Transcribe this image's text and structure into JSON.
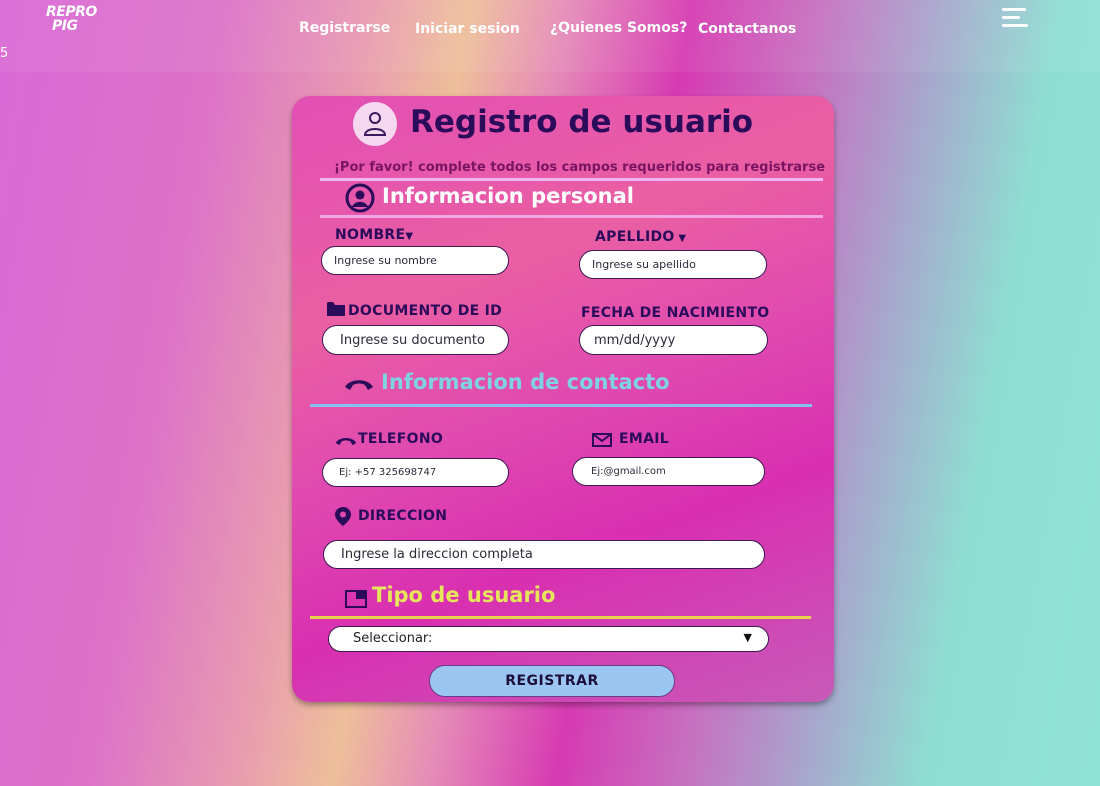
{
  "header": {
    "logo_line1": "REPRO",
    "logo_line2": "PIG",
    "stray_text": "5",
    "nav": [
      "Registrarse",
      "Iniciar sesion",
      "¿Quienes Somos?",
      "Contactanos"
    ],
    "menu_icon": "hamburger-icon"
  },
  "form": {
    "title": "Registro de usuario",
    "subtitle": "¡Por favor! complete todos los campos requeridos para registrarse",
    "sections": {
      "personal": "Informacion personal",
      "contact": "Informacion de contacto",
      "user_type": "Tipo de usuario"
    },
    "labels": {
      "nombre": "NOMBRE",
      "apellido": "APELLIDO",
      "documento": "DOCUMENTO DE ID",
      "fecha": "FECHA DE NACIMIENTO",
      "telefono": "TELEFONO",
      "email": "EMAIL",
      "direccion": "DIRECCION"
    },
    "placeholders": {
      "nombre": "Ingrese su nombre",
      "apellido": "Ingrese su apellido",
      "documento": "Ingrese su documento",
      "fecha": "mm/dd/yyyy",
      "telefono": "Ej: +57 325698747",
      "email": "Ej:@gmail.com",
      "direccion": "Ingrese la direccion completa"
    },
    "select_value": "Seleccionar:",
    "submit_label": "REGISTRAR"
  },
  "colors": {
    "title": "#2a0c5a",
    "section_personal": "#ffffff",
    "section_contact": "#7fd3e0",
    "section_user_type": "#e6e65a",
    "button": "#9cc6f2"
  }
}
